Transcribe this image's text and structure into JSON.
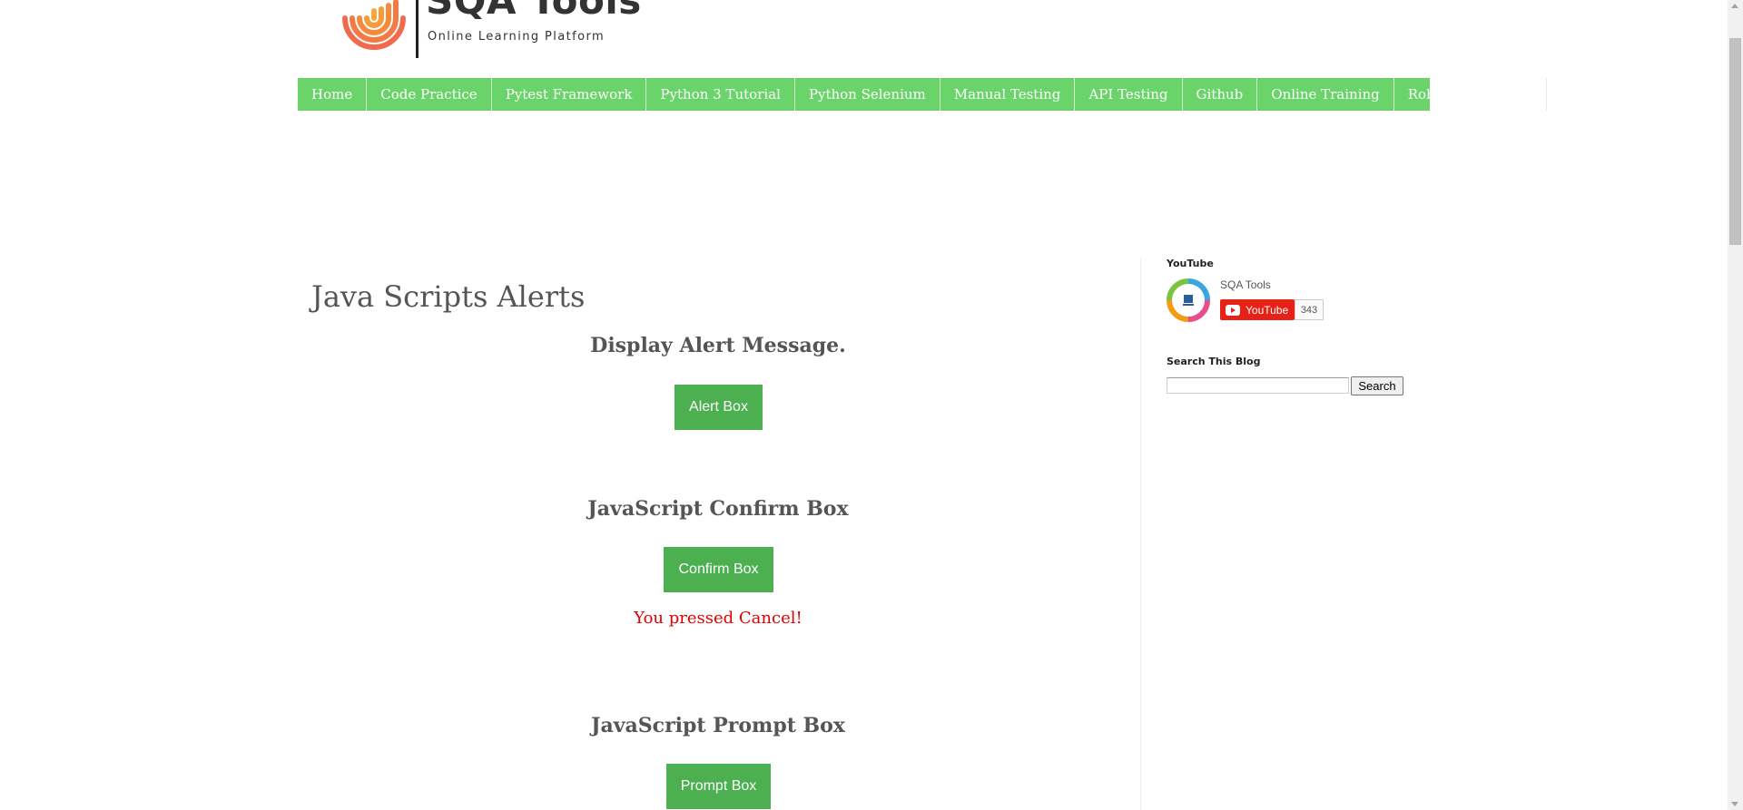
{
  "header": {
    "title": "SQA Tools",
    "subtitle": "Online Learning Platform"
  },
  "nav": {
    "items": [
      "Home",
      "Code Practice",
      "Pytest Framework",
      "Python 3 Tutorial",
      "Python Selenium",
      "Manual Testing",
      "API Testing",
      "Github",
      "Online Training",
      "Robot Framework"
    ]
  },
  "main": {
    "title": "Java Scripts Alerts",
    "alert_section": {
      "heading": "Display Alert Message.",
      "button": "Alert Box"
    },
    "confirm_section": {
      "heading": "JavaScript Confirm Box",
      "button": "Confirm Box",
      "result": "You pressed Cancel!"
    },
    "prompt_section": {
      "heading": "JavaScript Prompt Box",
      "button": "Prompt Box"
    }
  },
  "sidebar": {
    "youtube": {
      "title": "YouTube",
      "channel": "SQA Tools",
      "button": "YouTube",
      "subscribers": "343"
    },
    "search": {
      "title": "Search This Blog",
      "input_value": "",
      "button": "Search"
    }
  },
  "colors": {
    "nav_bg": "#6ad46a",
    "button_bg": "#4caf50",
    "result_text": "#e00000",
    "youtube_red": "#e62117"
  },
  "icons": [
    "fingerprint-logo-icon",
    "youtube-play-icon",
    "channel-avatar-icon"
  ]
}
